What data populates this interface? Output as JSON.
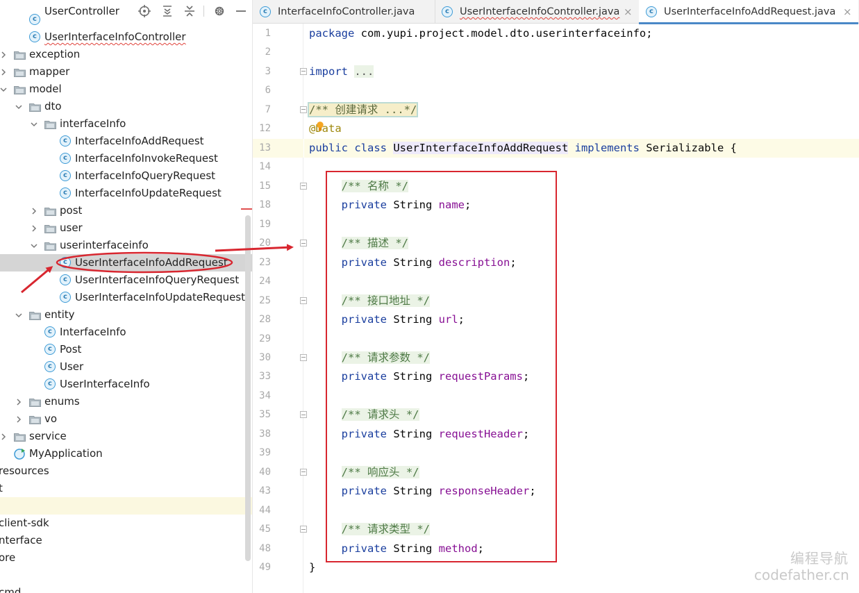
{
  "project_tree": [
    {
      "label": "UserController",
      "kind": "class",
      "depth": 1,
      "chevron": "",
      "partial": true
    },
    {
      "label": "UserInterfaceInfoController",
      "kind": "class",
      "depth": 1,
      "chevron": "",
      "wavy": true
    },
    {
      "label": "exception",
      "kind": "folder",
      "depth": 0,
      "chevron": "collapsed"
    },
    {
      "label": "mapper",
      "kind": "folder",
      "depth": 0,
      "chevron": "collapsed"
    },
    {
      "label": "model",
      "kind": "folder",
      "depth": 0,
      "chevron": "expanded"
    },
    {
      "label": "dto",
      "kind": "folder",
      "depth": 1,
      "chevron": "expanded"
    },
    {
      "label": "interfaceInfo",
      "kind": "folder",
      "depth": 2,
      "chevron": "expanded"
    },
    {
      "label": "InterfaceInfoAddRequest",
      "kind": "class",
      "depth": 3,
      "chevron": ""
    },
    {
      "label": "InterfaceInfoInvokeRequest",
      "kind": "class",
      "depth": 3,
      "chevron": ""
    },
    {
      "label": "InterfaceInfoQueryRequest",
      "kind": "class",
      "depth": 3,
      "chevron": ""
    },
    {
      "label": "InterfaceInfoUpdateRequest",
      "kind": "class",
      "depth": 3,
      "chevron": ""
    },
    {
      "label": "post",
      "kind": "folder",
      "depth": 2,
      "chevron": "collapsed"
    },
    {
      "label": "user",
      "kind": "folder",
      "depth": 2,
      "chevron": "collapsed"
    },
    {
      "label": "userinterfaceinfo",
      "kind": "folder",
      "depth": 2,
      "chevron": "expanded"
    },
    {
      "label": "UserInterfaceInfoAddRequest",
      "kind": "class",
      "depth": 3,
      "chevron": "",
      "selected": true
    },
    {
      "label": "UserInterfaceInfoQueryRequest",
      "kind": "class",
      "depth": 3,
      "chevron": ""
    },
    {
      "label": "UserInterfaceInfoUpdateRequest",
      "kind": "class",
      "depth": 3,
      "chevron": ""
    },
    {
      "label": "entity",
      "kind": "folder",
      "depth": 1,
      "chevron": "expanded"
    },
    {
      "label": "InterfaceInfo",
      "kind": "class",
      "depth": 2,
      "chevron": ""
    },
    {
      "label": "Post",
      "kind": "class",
      "depth": 2,
      "chevron": ""
    },
    {
      "label": "User",
      "kind": "class",
      "depth": 2,
      "chevron": ""
    },
    {
      "label": "UserInterfaceInfo",
      "kind": "class",
      "depth": 2,
      "chevron": ""
    },
    {
      "label": "enums",
      "kind": "folder",
      "depth": 1,
      "chevron": "collapsed"
    },
    {
      "label": "vo",
      "kind": "folder",
      "depth": 1,
      "chevron": "collapsed"
    },
    {
      "label": "service",
      "kind": "folder",
      "depth": 0,
      "chevron": "collapsed"
    },
    {
      "label": "MyApplication",
      "kind": "app",
      "depth": 0,
      "chevron": ""
    },
    {
      "label": "resources",
      "kind": "plain",
      "depth": -2,
      "chevron": ""
    },
    {
      "label": "t",
      "kind": "plain",
      "depth": -2,
      "chevron": ""
    },
    {
      "label": "",
      "kind": "plain",
      "depth": -2,
      "chevron": "",
      "hilite": true
    },
    {
      "label": "client-sdk",
      "kind": "plain",
      "depth": -2,
      "chevron": ""
    },
    {
      "label": "nterface",
      "kind": "plain",
      "depth": -2,
      "chevron": ""
    },
    {
      "label": "ore",
      "kind": "plain",
      "depth": -2,
      "chevron": ""
    },
    {
      "label": "",
      "kind": "plain",
      "depth": -2,
      "chevron": ""
    },
    {
      "label": "cmd",
      "kind": "plain",
      "depth": -2,
      "chevron": ""
    }
  ],
  "tabs": [
    {
      "label": "InterfaceInfoController.java",
      "active": false,
      "wavy": false,
      "close": false
    },
    {
      "label": "UserInterfaceInfoController.java",
      "active": false,
      "wavy": true,
      "close": true
    },
    {
      "label": "UserInterfaceInfoAddRequest.java",
      "active": true,
      "wavy": false,
      "close": true
    }
  ],
  "tab_close_glyph": "×",
  "code_lines": [
    {
      "ln": "1",
      "html": "<span class=\"kw\">package</span> com.yupi.project.model.dto.userinterfaceinfo;"
    },
    {
      "ln": "2",
      "html": ""
    },
    {
      "ln": "3",
      "html": "<span class=\"kw\">import</span> <span class=\"cm-bg\" style=\"color:#555\">...</span>",
      "fold": true
    },
    {
      "ln": "6",
      "html": ""
    },
    {
      "ln": "7",
      "html": "<span class=\"fold-comment cm\" style=\"color:#5d6b3f\">/** 创建请求 ...*/</span>",
      "fold": true
    },
    {
      "ln": "12",
      "html": "<span class=\"ann\">@Data</span>"
    },
    {
      "ln": "13",
      "html": "<span class=\"kw\">public class</span> <span class=\"cls-name\">UserInterfaceInfoAddRequest</span> <span class=\"kw\">implements</span> Serializable {",
      "current": true
    },
    {
      "ln": "14",
      "html": ""
    },
    {
      "ln": "15",
      "html": "     <span class=\"cm cm-bg\">/** 名称 */</span>",
      "fold": true
    },
    {
      "ln": "18",
      "html": "     <span class=\"kw\">private</span> String <span class=\"fld\">name</span>;"
    },
    {
      "ln": "19",
      "html": ""
    },
    {
      "ln": "20",
      "html": "     <span class=\"cm cm-bg\">/** 描述 */</span>",
      "fold": true
    },
    {
      "ln": "23",
      "html": "     <span class=\"kw\">private</span> String <span class=\"fld\">description</span>;"
    },
    {
      "ln": "24",
      "html": ""
    },
    {
      "ln": "25",
      "html": "     <span class=\"cm cm-bg\">/** 接口地址 */</span>",
      "fold": true
    },
    {
      "ln": "28",
      "html": "     <span class=\"kw\">private</span> String <span class=\"fld\">url</span>;"
    },
    {
      "ln": "29",
      "html": ""
    },
    {
      "ln": "30",
      "html": "     <span class=\"cm cm-bg\">/** 请求参数 */</span>",
      "fold": true
    },
    {
      "ln": "33",
      "html": "     <span class=\"kw\">private</span> String <span class=\"fld\">requestParams</span>;"
    },
    {
      "ln": "34",
      "html": ""
    },
    {
      "ln": "35",
      "html": "     <span class=\"cm cm-bg\">/** 请求头 */</span>",
      "fold": true
    },
    {
      "ln": "38",
      "html": "     <span class=\"kw\">private</span> String <span class=\"fld\">requestHeader</span>;"
    },
    {
      "ln": "39",
      "html": ""
    },
    {
      "ln": "40",
      "html": "     <span class=\"cm cm-bg\">/** 响应头 */</span>",
      "fold": true
    },
    {
      "ln": "43",
      "html": "     <span class=\"kw\">private</span> String <span class=\"fld\">responseHeader</span>;"
    },
    {
      "ln": "44",
      "html": ""
    },
    {
      "ln": "45",
      "html": "     <span class=\"cm cm-bg\">/** 请求类型 */</span>",
      "fold": true
    },
    {
      "ln": "48",
      "html": "     <span class=\"kw\">private</span> String <span class=\"fld\">method</span>;"
    },
    {
      "ln": "49",
      "html": "}"
    }
  ],
  "watermark": {
    "line1": "编程导航",
    "line2": "codefather.cn"
  },
  "colors": {
    "annotation_red": "#d8262f",
    "accent_blue": "#4a88c7"
  }
}
